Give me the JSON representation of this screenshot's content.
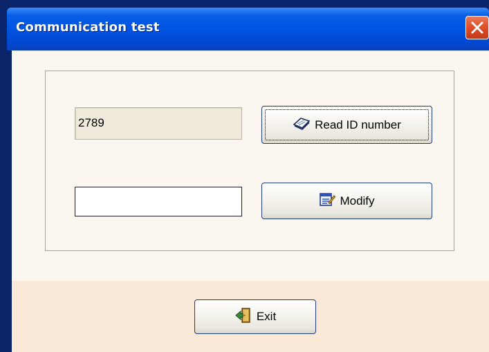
{
  "window": {
    "title": "Communication test"
  },
  "id_display": {
    "value": "2789"
  },
  "buttons": {
    "read_id": "Read ID number",
    "modify": "Modify",
    "exit": "Exit"
  },
  "modify_input": {
    "value": ""
  },
  "icons": {
    "close": "close-icon",
    "read": "book-icon",
    "modify": "notepad-edit-icon",
    "exit": "exit-door-icon"
  },
  "colors": {
    "titlebar": "#0054e3",
    "close_button": "#e0502a",
    "content_bg": "#fbf6ef",
    "footer_bg": "#fbe9d8"
  }
}
